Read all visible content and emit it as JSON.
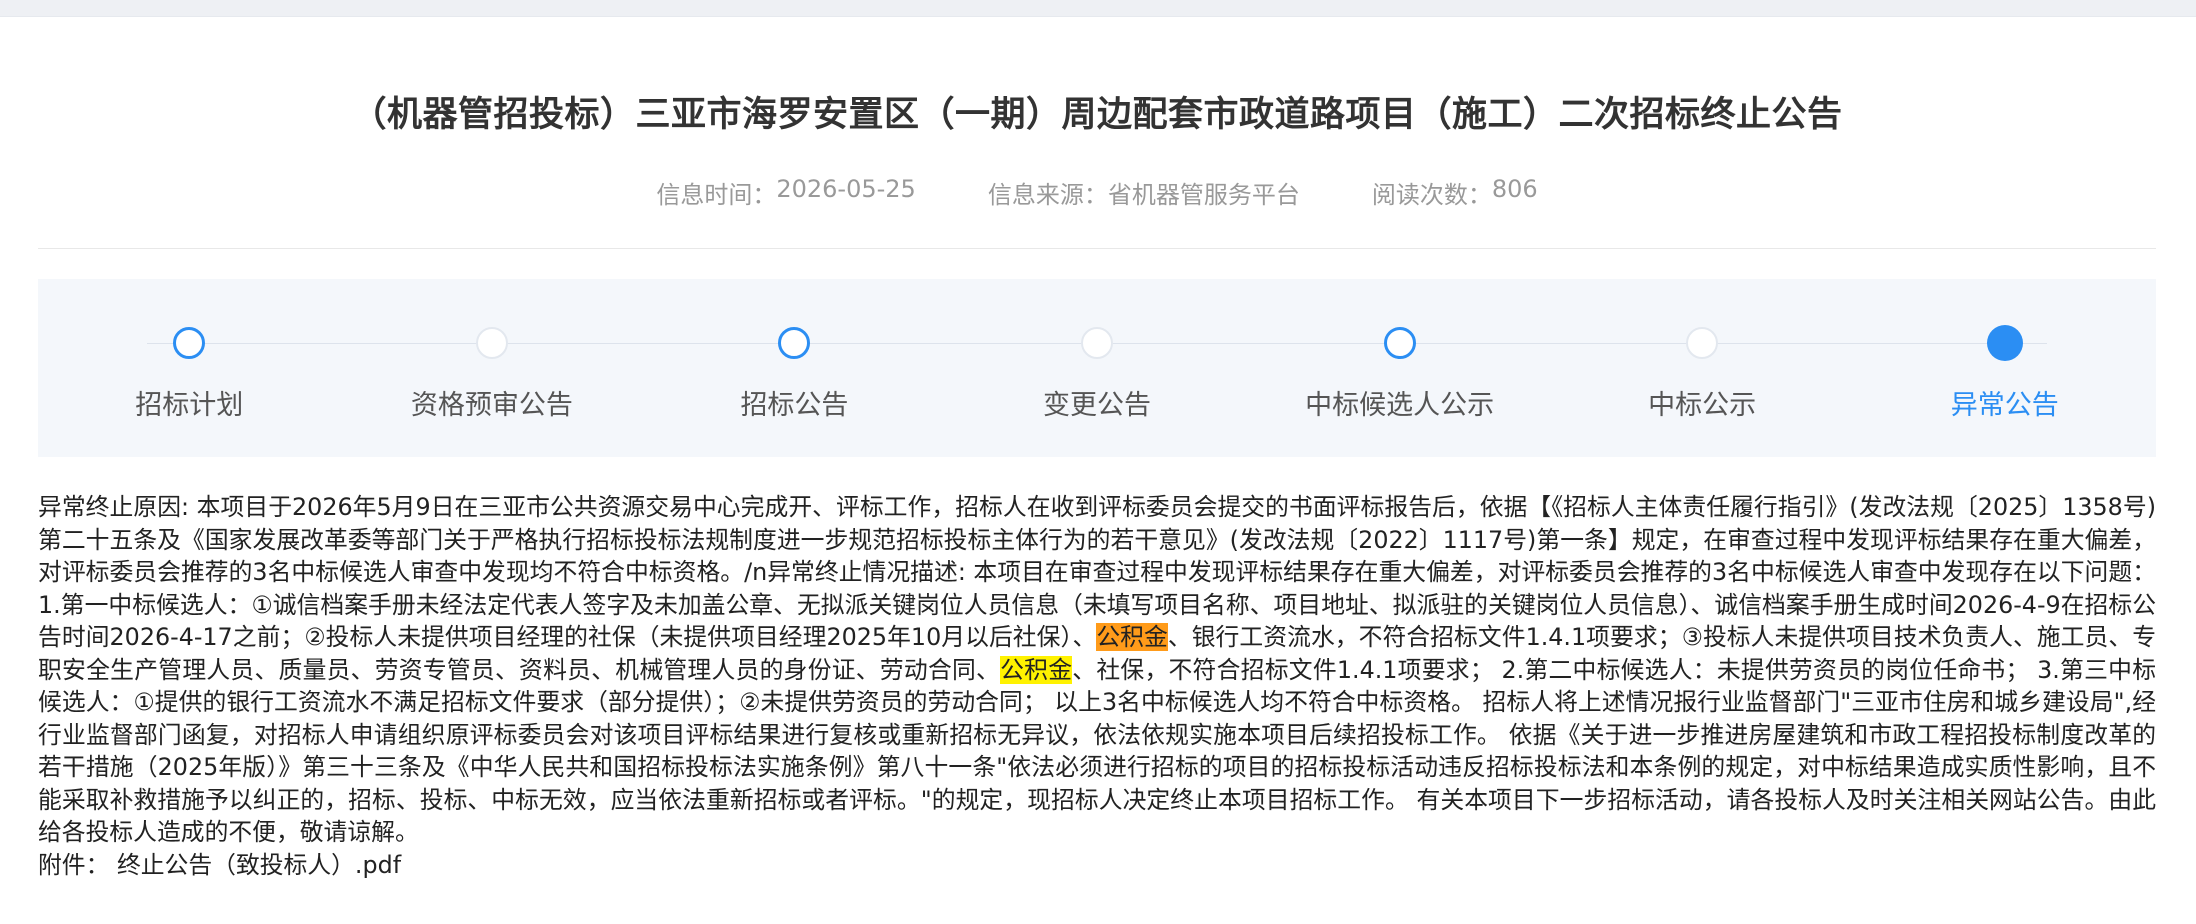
{
  "title": "（机器管招投标）三亚市海罗安置区（一期）周边配套市政道路项目（施工）二次招标终止公告",
  "meta": {
    "time_label": "信息时间：",
    "time_value": "2026-05-25",
    "source_label": "信息来源：",
    "source_value": "省机器管服务平台",
    "reads_label": "阅读次数：",
    "reads_value": "806"
  },
  "steps": [
    {
      "label": "招标计划",
      "state": "active"
    },
    {
      "label": "资格预审公告",
      "state": "pending"
    },
    {
      "label": "招标公告",
      "state": "active"
    },
    {
      "label": "变更公告",
      "state": "pending"
    },
    {
      "label": "中标候选人公示",
      "state": "active"
    },
    {
      "label": "中标公示",
      "state": "pending"
    },
    {
      "label": "异常公告",
      "state": "current"
    }
  ],
  "body": {
    "p1": "异常终止原因: 本项目于2026年5月9日在三亚市公共资源交易中心完成开、评标工作，招标人在收到评标委员会提交的书面评标报告后，依据【《招标人主体责任履行指引》(发改法规〔2025〕1358号)第二十五条及《国家发展改革委等部门关于严格执行招标投标法规制度进一步规范招标投标主体行为的若干意见》(发改法规〔2022〕1117号)第一条】规定，在审查过程中发现评标结果存在重大偏差，对评标委员会推荐的3名中标候选人审查中发现均不符合中标资格。/n异常终止情况描述: 本项目在审查过程中发现评标结果存在重大偏差，对评标委员会推荐的3名中标候选人审查中发现存在以下问题： 1.第一中标候选人：①诚信档案手册未经法定代表人签字及未加盖公章、无拟派关键岗位人员信息（未填写项目名称、项目地址、拟派驻的关键岗位人员信息）、诚信档案手册生成时间2026-4-9在招标公告时间2026-4-17之前；②投标人未提供项目经理的社保（未提供项目经理2025年10月以后社保）、",
    "hl1": "公积金",
    "p2": "、银行工资流水，不符合招标文件1.4.1项要求；③投标人未提供项目技术负责人、施工员、专职安全生产管理人员、质量员、劳资专管员、资料员、机械管理人员的身份证、劳动合同、",
    "hl2": "公积金",
    "p3": "、社保，不符合招标文件1.4.1项要求； 2.第二中标候选人：未提供劳资员的岗位任命书； 3.第三中标候选人：①提供的银行工资流水不满足招标文件要求（部分提供）；②未提供劳资员的劳动合同； 以上3名中标候选人均不符合中标资格。 招标人将上述情况报行业监督部门\"三亚市住房和城乡建设局\",经行业监督部门函复，对招标人申请组织原评标委员会对该项目评标结果进行复核或重新招标无异议，依法依规实施本项目后续招投标工作。 依据《关于进一步推进房屋建筑和市政工程招投标制度改革的若干措施（2025年版）》第三十三条及《中华人民共和国招标投标法实施条例》第八十一条\"依法必须进行招标的项目的招标投标活动违反招标投标法和本条例的规定，对中标结果造成实质性影响，且不能采取补救措施予以纠正的，招标、投标、中标无效，应当依法重新招标或者评标。\"的规定，现招标人决定终止本项目招标工作。 有关本项目下一步招标活动，请各投标人及时关注相关网站公告。由此给各投标人造成的不便，敬请谅解。"
  },
  "attachment": {
    "label": "附件：",
    "file": "终止公告（致投标人）.pdf"
  }
}
